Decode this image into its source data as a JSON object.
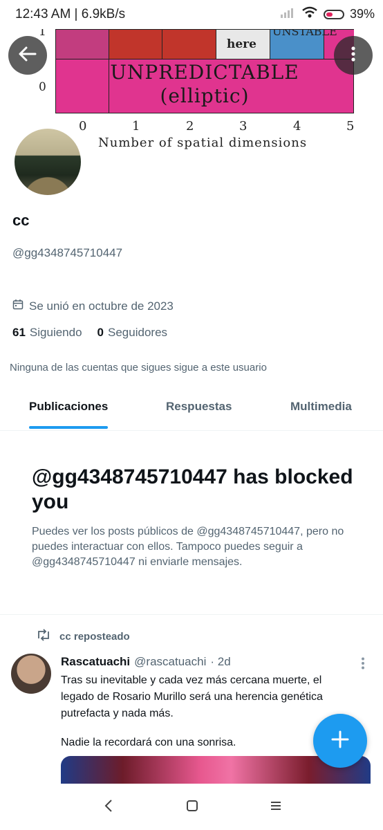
{
  "status_bar": {
    "time": "12:43 AM | 6.9kB/s",
    "battery": "39%"
  },
  "banner": {
    "row_labels": [
      "1",
      "0"
    ],
    "cell_here": "here",
    "cell_unstable": "UNSTABLE",
    "main_text_line1": "UNPREDICTABLE",
    "main_text_line2": "(elliptic)",
    "x_ticks": [
      "0",
      "1",
      "2",
      "3",
      "4",
      "5"
    ],
    "x_axis_label": "Number of spatial dimensions"
  },
  "profile": {
    "name": "cc",
    "handle": "@gg4348745710447",
    "joined": "Se unió en octubre de 2023",
    "following_count": "61",
    "following_label": "Siguiendo",
    "followers_count": "0",
    "followers_label": "Seguidores",
    "no_mutuals": "Ninguna de las cuentas que sigues sigue a este usuario"
  },
  "tabs": [
    {
      "label": "Publicaciones",
      "active": true
    },
    {
      "label": "Respuestas",
      "active": false
    },
    {
      "label": "Multimedia",
      "active": false
    }
  ],
  "blocked_notice": {
    "title": "@gg4348745710447 has blocked you",
    "body": "Puedes ver los posts públicos de @gg4348745710447, pero no puedes interactuar con ellos. Tampoco puedes seguir a @gg4348745710447 ni enviarle mensajes."
  },
  "tweet": {
    "repost_label": "cc reposteado",
    "author_name": "Rascatuachi",
    "author_handle": "@rascatuachi",
    "time": "· 2d",
    "text": "Tras su inevitable y cada vez más cercana muerte, el legado de Rosario Murillo será una herencia genética putrefacta y nada más.",
    "text2": "Nadie la recordará con una sonrisa."
  },
  "icons": {
    "back": "back-arrow-icon",
    "more": "more-vertical-icon",
    "calendar": "calendar-icon",
    "repost": "repost-icon",
    "compose": "plus-icon"
  },
  "colors": {
    "accent": "#1d9bf0",
    "banner_pink": "#e0348f",
    "banner_red": "#c1352b",
    "banner_blue": "#4a90c9"
  }
}
